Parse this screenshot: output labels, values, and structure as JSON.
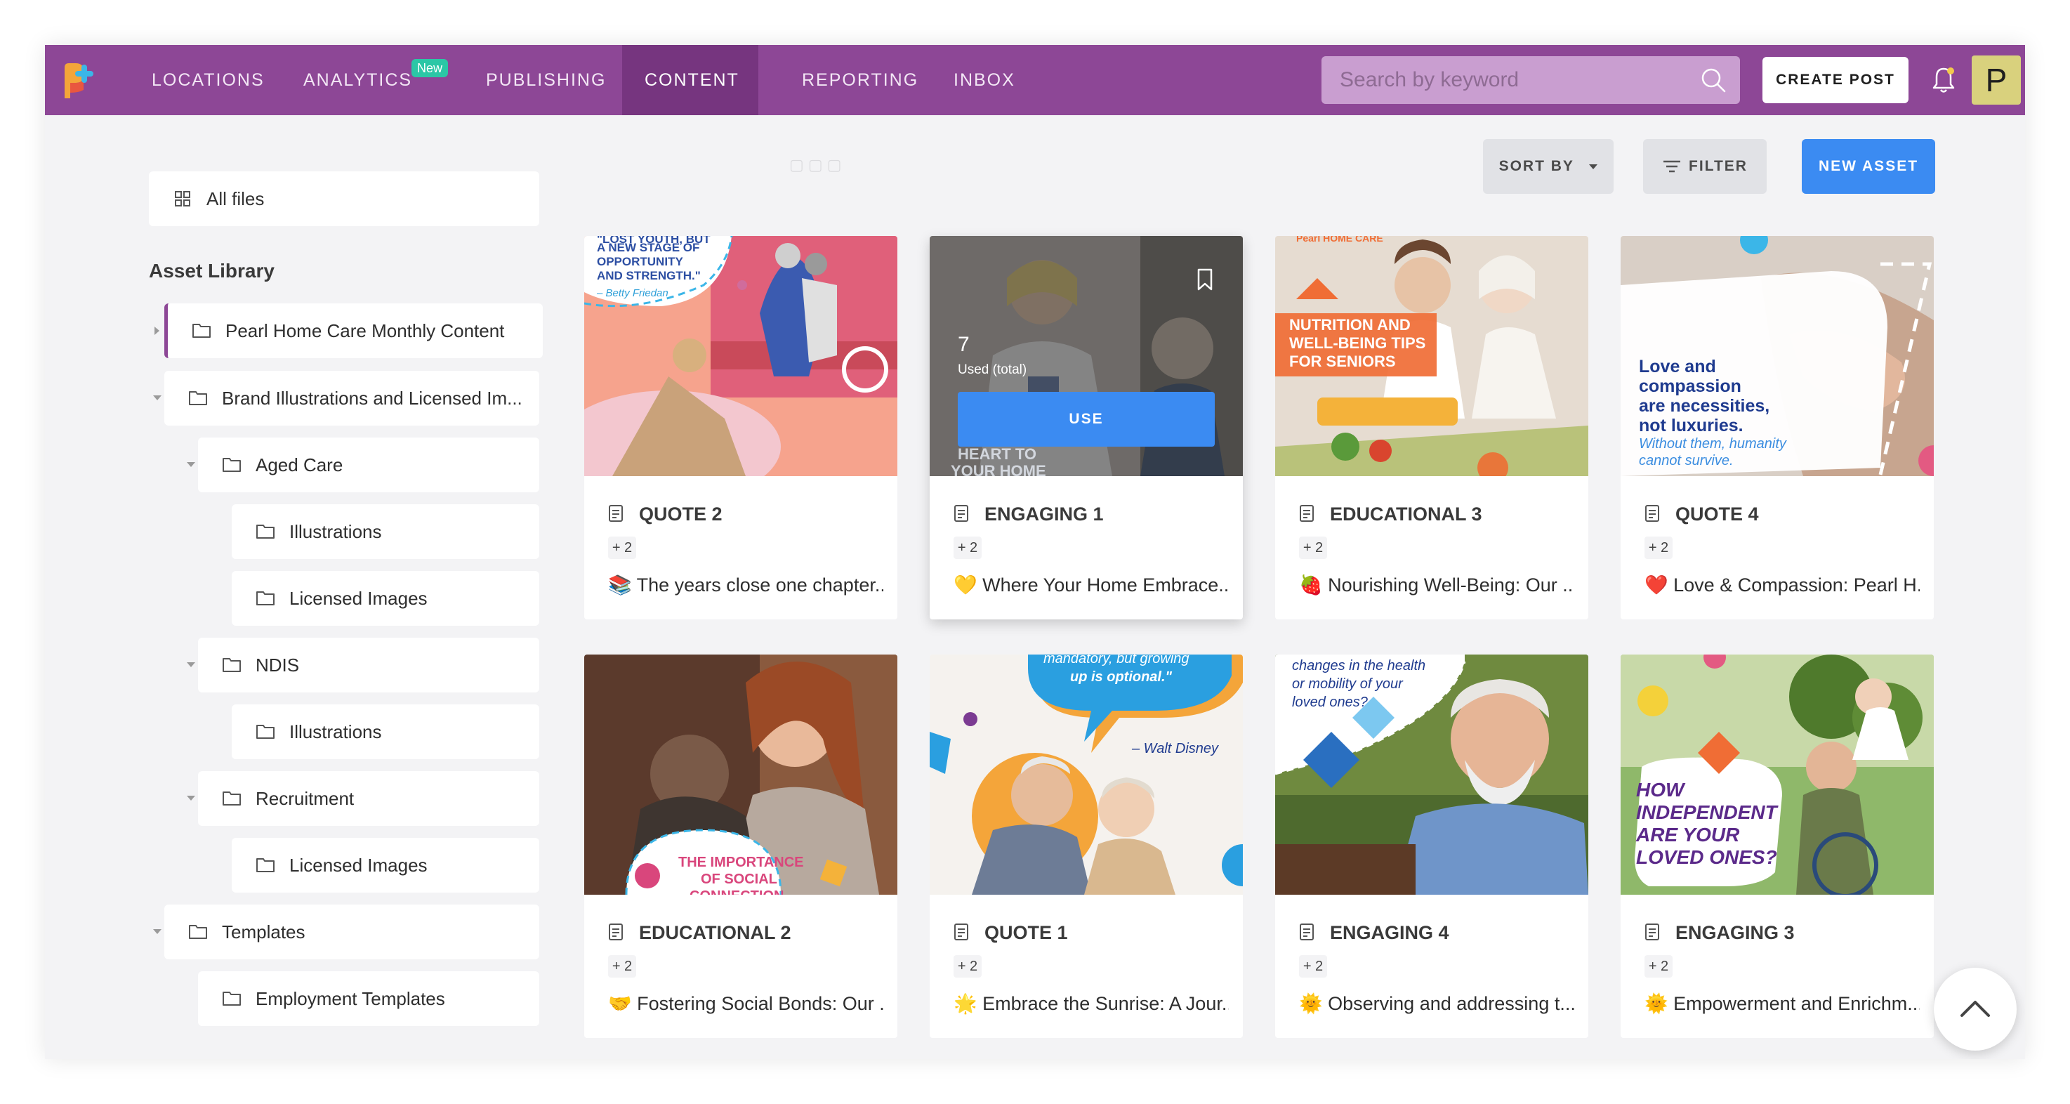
{
  "nav": {
    "items": [
      "LOCATIONS",
      "ANALYTICS",
      "PUBLISHING",
      "CONTENT",
      "REPORTING",
      "INBOX"
    ],
    "active": "CONTENT",
    "new_badge": "New",
    "search_placeholder": "Search by keyword",
    "create_post": "CREATE POST",
    "avatar_letter": "P"
  },
  "toolbar": {
    "sort_by": "SORT BY",
    "filter": "FILTER",
    "new_asset": "NEW ASSET"
  },
  "sidebar": {
    "all_files": "All files",
    "library_title": "Asset Library",
    "tree": [
      {
        "label": "Pearl Home Care Monthly Content",
        "caret": "right",
        "selected": true
      },
      {
        "label": "Brand Illustrations and Licensed Im...",
        "caret": "down"
      },
      {
        "label": "Aged Care",
        "caret": "down"
      },
      {
        "label": "Illustrations"
      },
      {
        "label": "Licensed Images"
      },
      {
        "label": "NDIS",
        "caret": "down"
      },
      {
        "label": "Illustrations"
      },
      {
        "label": "Recruitment",
        "caret": "down"
      },
      {
        "label": "Licensed Images"
      },
      {
        "label": "Templates",
        "caret": "down"
      },
      {
        "label": "Employment Templates"
      }
    ]
  },
  "cards": [
    {
      "title": "QUOTE 2",
      "more": "+ 2",
      "emoji": "📚",
      "desc": "The years close one chapter...",
      "thumb_text": [
        "\"LOST YOUTH, BUT",
        "A NEW STAGE OF",
        "OPPORTUNITY",
        "AND STRENGTH.\"",
        "– Betty Friedan"
      ]
    },
    {
      "title": "ENGAGING 1",
      "more": "+ 2",
      "emoji": "💛",
      "desc": "Where Your Home Embrace...",
      "overlay": {
        "count": "7",
        "label": "Used (total)",
        "use": "USE"
      },
      "thumb_text": [
        "HEART TO",
        "YOUR HOME"
      ]
    },
    {
      "title": "EDUCATIONAL 3",
      "more": "+ 2",
      "emoji": "🍓",
      "desc": "Nourishing Well-Being: Our ...",
      "thumb_text": [
        "NUTRITION AND",
        "WELL-BEING TIPS",
        "FOR SENIORS",
        "Pearl HOME CARE"
      ]
    },
    {
      "title": "QUOTE 4",
      "more": "+ 2",
      "emoji": "❤️",
      "desc": "Love & Compassion: Pearl H...",
      "thumb_text": [
        "Love and",
        "compassion",
        "are necessities,",
        "not luxuries.",
        "Without them, humanity",
        "cannot survive."
      ]
    },
    {
      "title": "EDUCATIONAL 2",
      "more": "+ 2",
      "emoji": "🤝",
      "desc": "Fostering Social Bonds: Our ...",
      "thumb_text": [
        "THE IMPORTANCE",
        "OF SOCIAL",
        "CONNECTION"
      ]
    },
    {
      "title": "QUOTE 1",
      "more": "+ 2",
      "emoji": "🌟",
      "desc": "Embrace the Sunrise: A Jour...",
      "thumb_text": [
        "mandatory, but growing",
        "up is optional.\"",
        "– Walt Disney"
      ]
    },
    {
      "title": "ENGAGING 4",
      "more": "+ 2",
      "emoji": "🌞",
      "desc": "Observing and addressing t...",
      "thumb_text": [
        "changes in the health",
        "or mobility of your",
        "loved ones?"
      ]
    },
    {
      "title": "ENGAGING 3",
      "more": "+ 2",
      "emoji": "🌞",
      "desc": "Empowerment and Enrichm...",
      "thumb_text": [
        "HOW",
        "INDEPENDENT",
        "ARE YOUR",
        "LOVED ONES?"
      ]
    }
  ],
  "colors": {
    "brand": "#8d4796",
    "nav_active": "#76357f",
    "accent_blue": "#3b8bf2",
    "new_badge": "#2bc7a6"
  }
}
